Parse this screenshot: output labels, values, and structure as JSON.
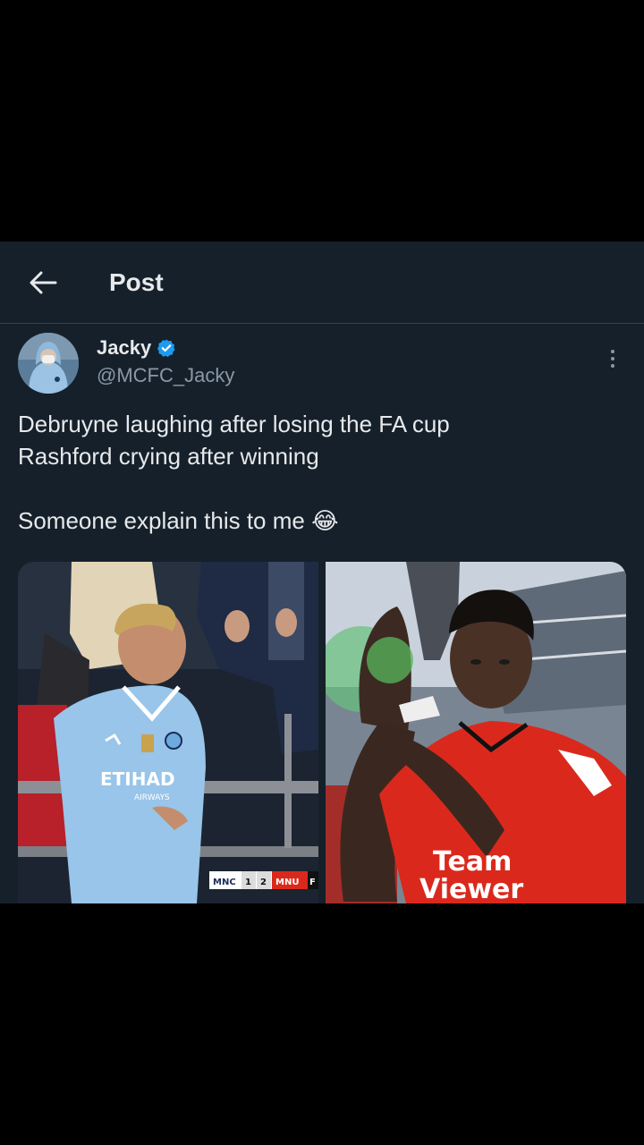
{
  "header": {
    "title": "Post"
  },
  "author": {
    "name": "Jacky",
    "handle": "@MCFC_Jacky",
    "verified": true
  },
  "post": {
    "lines": [
      "Debruyne laughing after losing the FA cup",
      "Rashford crying after winning",
      "",
      "Someone explain this to me 😂"
    ]
  },
  "media": {
    "left": {
      "sponsor": "ETIHAD",
      "sponsor_sub": "AIRWAYS",
      "scoreboard": {
        "home": "MNC",
        "home_score": "1",
        "away_score": "2",
        "away": "MNU",
        "extra": "F"
      }
    },
    "right": {
      "sponsor": "Team",
      "sponsor2": "Viewer"
    }
  },
  "colors": {
    "background": "#15202b",
    "accent": "#1d9bf0",
    "text": "#e7e9ea",
    "muted": "#8b98a5",
    "city_blue": "#98c5e9",
    "united_red": "#da291c"
  },
  "icons": {
    "back": "arrow-left-icon",
    "verified": "verified-badge-icon",
    "more": "more-vertical-icon"
  }
}
